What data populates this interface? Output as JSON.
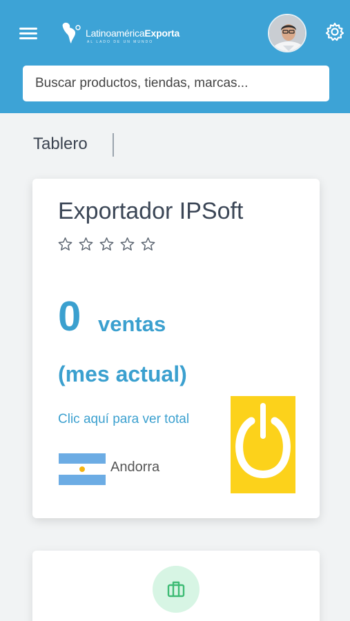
{
  "header": {
    "logo": {
      "name_light": "Latinoamérica",
      "name_bold": "Exporta",
      "tagline": "AL LADO DE UN MUNDO"
    },
    "menu_icon": "hamburger-menu-icon",
    "settings_icon": "gear-icon",
    "avatar_alt": "user-avatar"
  },
  "search": {
    "placeholder": "Buscar productos, tiendas, marcas..."
  },
  "breadcrumb": {
    "current": "Tablero"
  },
  "colors": {
    "brand_blue": "#3da3d6",
    "accent_text": "#3ba0cf",
    "power_tile": "#fcd21b",
    "mint": "#d7f5e4"
  },
  "exporter_card": {
    "title": "Exportador IPSoft",
    "rating": {
      "filled": 0,
      "max": 5
    },
    "sales_count": "0",
    "sales_label": "ventas",
    "period_label": "(mes actual)",
    "total_link": "Clic aquí para ver total",
    "country": "Andorra",
    "flag_icon": "argentina-flag-icon",
    "power_icon": "power-icon"
  },
  "second_card": {
    "icon": "briefcase-icon"
  }
}
